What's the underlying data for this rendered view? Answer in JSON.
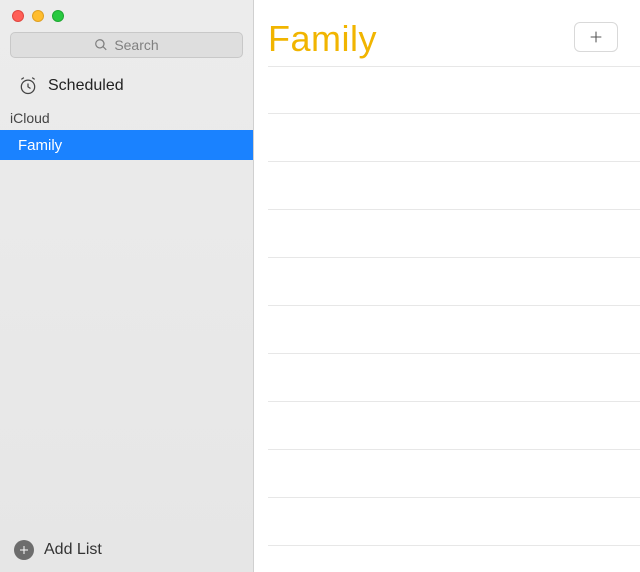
{
  "search": {
    "placeholder": "Search"
  },
  "smart_lists": {
    "scheduled_label": "Scheduled"
  },
  "sections": [
    {
      "title": "iCloud",
      "lists": [
        {
          "name": "Family",
          "selected": true
        }
      ]
    }
  ],
  "sidebar_footer": {
    "add_list_label": "Add List"
  },
  "main": {
    "title": "Family",
    "title_color": "#f1b500",
    "reminder_rows": 10
  }
}
